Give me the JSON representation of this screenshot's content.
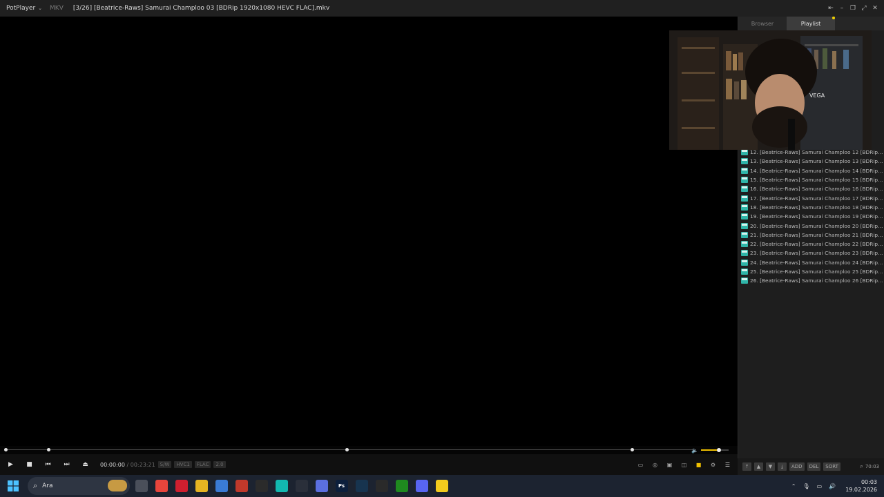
{
  "titlebar": {
    "app_name": "PotPlayer",
    "format": "MKV",
    "file_title": "[3/26] [Beatrice-Raws] Samurai Champloo 03 [BDRip 1920x1080 HEVC FLAC].mkv"
  },
  "panel": {
    "tabs": [
      {
        "label": "Browser",
        "active": false
      },
      {
        "label": "Playlist",
        "active": true
      }
    ]
  },
  "webcam": {
    "overlay_text": "VEGA"
  },
  "playlist": {
    "items": [
      "12. [Beatrice-Raws] Samurai Champloo 12 [BDRip 1...",
      "13. [Beatrice-Raws] Samurai Champloo 13 [BDRip 1...",
      "14. [Beatrice-Raws] Samurai Champloo 14 [BDRip 1...",
      "15. [Beatrice-Raws] Samurai Champloo 15 [BDRip 1...",
      "16. [Beatrice-Raws] Samurai Champloo 16 [BDRip 1...",
      "17. [Beatrice-Raws] Samurai Champloo 17 [BDRip 1...",
      "18. [Beatrice-Raws] Samurai Champloo 18 [BDRip 1...",
      "19. [Beatrice-Raws] Samurai Champloo 19 [BDRip 1...",
      "20. [Beatrice-Raws] Samurai Champloo 20 [BDRip 1...",
      "21. [Beatrice-Raws] Samurai Champloo 21 [BDRip 1...",
      "22. [Beatrice-Raws] Samurai Champloo 22 [BDRip 1...",
      "23. [Beatrice-Raws] Samurai Champloo 23 [BDRip 1...",
      "24. [Beatrice-Raws] Samurai Champloo 24 [BDRip 1...",
      "25. [Beatrice-Raws] Samurai Champloo 25 [BDRip 1...",
      "26. [Beatrice-Raws] Samurai Champloo 26 [BDRip 1..."
    ],
    "icon": "mkv-file-icon",
    "controls": [
      "ADD",
      "DEL",
      "SORT"
    ],
    "count": "70:03"
  },
  "player": {
    "current_time": "00:00:00",
    "separator": "/",
    "total_time": "00:23:21",
    "badges": [
      "S/W",
      "HVC1",
      "FLAC",
      "2.0"
    ],
    "volume_level": 0.65,
    "accent_color": "#f0c000"
  },
  "taskbar": {
    "search_placeholder": "Ara",
    "time": "00:03",
    "date": "19.02.2026",
    "apps": [
      {
        "name": "task-view",
        "color": "#4a4f5a",
        "label": ""
      },
      {
        "name": "chrome",
        "color": "#e8453c",
        "label": ""
      },
      {
        "name": "opera",
        "color": "#d01f2f",
        "label": ""
      },
      {
        "name": "file-explorer",
        "color": "#e6b422",
        "label": ""
      },
      {
        "name": "store",
        "color": "#3a7bd5",
        "label": ""
      },
      {
        "name": "netflix",
        "color": "#c0392b",
        "label": ""
      },
      {
        "name": "obs",
        "color": "#2b2b2b",
        "label": ""
      },
      {
        "name": "app-teal",
        "color": "#12b8b0",
        "label": ""
      },
      {
        "name": "app-vector",
        "color": "#2a2f3a",
        "label": ""
      },
      {
        "name": "m365",
        "color": "#5b6fe0",
        "label": ""
      },
      {
        "name": "photoshop",
        "color": "#0c1f3c",
        "label": "Ps"
      },
      {
        "name": "steam",
        "color": "#17344f",
        "label": ""
      },
      {
        "name": "epic-games",
        "color": "#2a2a2a",
        "label": ""
      },
      {
        "name": "xbox",
        "color": "#1f8a1f",
        "label": ""
      },
      {
        "name": "discord",
        "color": "#5865f2",
        "label": ""
      },
      {
        "name": "potplayer",
        "color": "#f2cb1d",
        "label": ""
      }
    ]
  }
}
